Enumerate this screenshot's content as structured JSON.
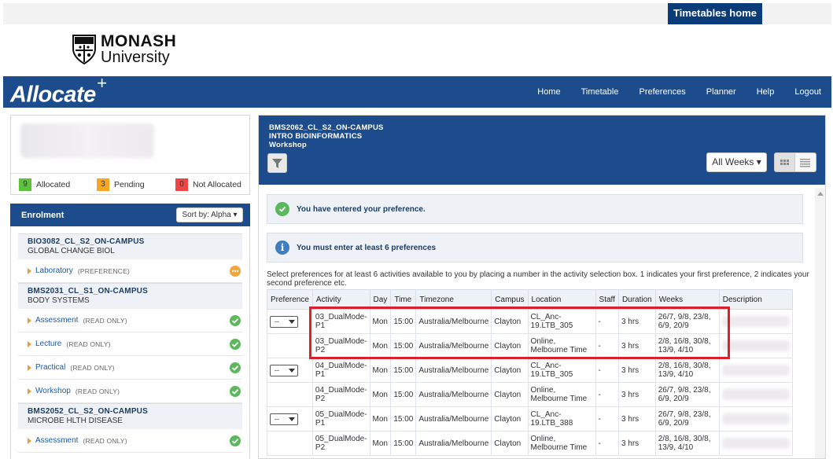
{
  "header": {
    "timetables_home": "Timetables home",
    "university": {
      "line1": "MONASH",
      "line2": "University"
    },
    "app_name": "Allocate",
    "app_plus": "+",
    "nav": [
      "Home",
      "Timetable",
      "Preferences",
      "Planner",
      "Help",
      "Logout"
    ]
  },
  "summary": {
    "allocated": {
      "count": "9",
      "label": "Allocated",
      "color": "#5cc23b"
    },
    "pending": {
      "count": "3",
      "label": "Pending",
      "color": "#f5a623"
    },
    "not_allocated": {
      "count": "0",
      "label": "Not Allocated",
      "color": "#f04545"
    }
  },
  "enrolment": {
    "title": "Enrolment",
    "sort_label": "Sort by: Alpha",
    "courses": [
      {
        "code": "BIO3082_CL_S2_ON-CAMPUS",
        "name": "GLOBAL CHANGE BIOL",
        "activities": [
          {
            "name": "Laboratory",
            "status": "(PREFERENCE)",
            "icon": "pending-icon"
          }
        ]
      },
      {
        "code": "BMS2031_CL_S1_ON-CAMPUS",
        "name": "BODY SYSTEMS",
        "activities": [
          {
            "name": "Assessment",
            "status": "(READ ONLY)",
            "icon": "check-icon"
          },
          {
            "name": "Lecture",
            "status": "(READ ONLY)",
            "icon": "check-icon"
          },
          {
            "name": "Practical",
            "status": "(READ ONLY)",
            "icon": "check-icon"
          },
          {
            "name": "Workshop",
            "status": "(READ ONLY)",
            "icon": "check-icon"
          }
        ]
      },
      {
        "code": "BMS2052_CL_S2_ON-CAMPUS",
        "name": "MICROBE HLTH DISEASE",
        "activities": [
          {
            "name": "Assessment",
            "status": "(READ ONLY)",
            "icon": "check-icon"
          }
        ]
      }
    ]
  },
  "panel": {
    "course_code": "BMS2062_CL_S2_ON-CAMPUS",
    "course_name": "INTRO BIOINFORMATICS",
    "activity_type": "Workshop",
    "weeks_selector": "All Weeks",
    "msg_success": "You have entered your preference.",
    "msg_info": "You must enter at least 6 preferences",
    "instructions": "Select preferences for at least 6 activities available to you by placing a number in the activity selection box. 1 indicates your first preference, 2 indicates your second preference etc.",
    "select_value": "--",
    "columns": [
      "Preference",
      "Activity",
      "Day",
      "Time",
      "Timezone",
      "Campus",
      "Location",
      "Staff",
      "Duration",
      "Weeks",
      "Description"
    ],
    "rows": [
      {
        "select": true,
        "activity": [
          "03_DualMode-",
          "P1"
        ],
        "day": "Mon",
        "time": "15:00",
        "tz": "Australia/Melbourne",
        "campus": "Clayton",
        "location": [
          "CL_Anc-",
          "19.LTB_305"
        ],
        "staff": "-",
        "duration": "3 hrs",
        "weeks": [
          "26/7, 9/8, 23/8,",
          "6/9, 20/9"
        ]
      },
      {
        "select": false,
        "activity": [
          "03_DualMode-",
          "P2"
        ],
        "day": "Mon",
        "time": "15:00",
        "tz": "Australia/Melbourne",
        "campus": "Clayton",
        "location": [
          "Online,",
          "Melbourne Time"
        ],
        "staff": "-",
        "duration": "3 hrs",
        "weeks": [
          "2/8, 16/8, 30/8,",
          "13/9, 4/10"
        ]
      },
      {
        "select": true,
        "activity": [
          "04_DualMode-",
          "P1"
        ],
        "day": "Mon",
        "time": "15:00",
        "tz": "Australia/Melbourne",
        "campus": "Clayton",
        "location": [
          "CL_Anc-",
          "19.LTB_305"
        ],
        "staff": "-",
        "duration": "3 hrs",
        "weeks": [
          "2/8, 16/8, 30/8,",
          "13/9, 4/10"
        ]
      },
      {
        "select": false,
        "activity": [
          "04_DualMode-",
          "P2"
        ],
        "day": "Mon",
        "time": "15:00",
        "tz": "Australia/Melbourne",
        "campus": "Clayton",
        "location": [
          "Online,",
          "Melbourne Time"
        ],
        "staff": "-",
        "duration": "3 hrs",
        "weeks": [
          "26/7, 9/8, 23/8,",
          "6/9, 20/9"
        ]
      },
      {
        "select": true,
        "activity": [
          "05_DualMode-",
          "P1"
        ],
        "day": "Mon",
        "time": "15:00",
        "tz": "Australia/Melbourne",
        "campus": "Clayton",
        "location": [
          "CL_Anc-",
          "19.LTB_388"
        ],
        "staff": "-",
        "duration": "3 hrs",
        "weeks": [
          "26/7, 9/8, 23/8,",
          "6/9, 20/9"
        ]
      },
      {
        "select": false,
        "activity": [
          "05_DualMode-",
          "P2"
        ],
        "day": "Mon",
        "time": "15:00",
        "tz": "Australia/Melbourne",
        "campus": "Clayton",
        "location": [
          "Online,",
          "Melbourne Time"
        ],
        "staff": "-",
        "duration": "3 hrs",
        "weeks": [
          "2/8, 16/8, 30/8,",
          "13/9, 4/10"
        ]
      }
    ]
  }
}
